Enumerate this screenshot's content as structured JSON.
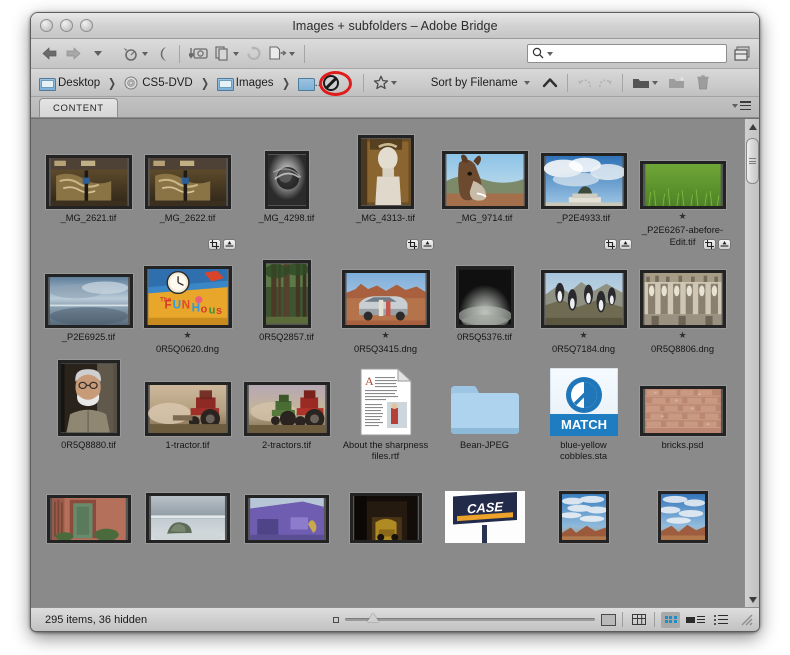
{
  "window": {
    "title": "Images + subfolders – Adobe Bridge",
    "traffic_lights": [
      "close-button",
      "minimize-button",
      "zoom-button"
    ]
  },
  "toolbar": {
    "back_icon": "back-arrow-icon",
    "forward_icon": "forward-arrow-icon",
    "recent_dropdown_icon": "chevron-down-icon",
    "reveal_icon": "reveal-in-finder-icon",
    "boomerang_icon": "return-to-adobe-icon",
    "camera_icon": "get-photos-from-camera-icon",
    "refine_icon": "refine-icon",
    "rotate_icon": "rotate-counterclockwise-icon",
    "open_in_icon": "open-in-camera-raw-icon",
    "search_placeholder": "",
    "search_value": "",
    "search_icon": "search-icon",
    "panel_toggle_icon": "toggle-panels-icon"
  },
  "pathbar": {
    "crumbs": [
      {
        "label": "Desktop",
        "icon": "folder-icon"
      },
      {
        "label": "CS5-DVD",
        "icon": "disc-icon"
      },
      {
        "label": "Images",
        "icon": "folder-icon"
      }
    ],
    "drag_target": {
      "icon": "no-entry-cursor-icon",
      "annotation": "red-highlight-ellipse"
    },
    "separator": "❯",
    "filter_icon": "star-filter-icon",
    "sort_label": "Sort by Filename",
    "sort_direction_icon": "chevron-up-icon",
    "undo_icon": "undo-icon",
    "redo_icon": "redo-icon",
    "new_folder_icon": "open-folder-icon",
    "create_folder_icon": "new-folder-icon",
    "delete_icon": "trash-icon"
  },
  "tabs": [
    {
      "label": "CONTENT",
      "active": true
    }
  ],
  "panel_menu_icon": "panel-menu-icon",
  "content": {
    "rows": [
      {
        "items": [
          {
            "name": "_MG_2621.tif",
            "art": "frieze",
            "stars": 0,
            "badges": []
          },
          {
            "name": "_MG_2622.tif",
            "art": "frieze",
            "stars": 0,
            "badges": []
          },
          {
            "name": "_MG_4298.tif",
            "art": "sphere-bw",
            "stars": 0,
            "badges": []
          },
          {
            "name": "_MG_4313-.tif",
            "art": "bust",
            "stars": 0,
            "badges": []
          },
          {
            "name": "_MG_9714.tif",
            "art": "okapi",
            "stars": 0,
            "badges": []
          },
          {
            "name": "_P2E4933.tif",
            "art": "monument-sky",
            "stars": 0,
            "badges": []
          },
          {
            "name": "_P2E6267-abefore-Edit.tif",
            "art": "grass",
            "stars": 1,
            "badges": []
          }
        ]
      },
      {
        "items": [
          {
            "name": "_P2E6925.tif",
            "art": "seascape",
            "stars": 0,
            "badges": []
          },
          {
            "name": "0R5Q0620.dng",
            "art": "funhouse",
            "stars": 1,
            "badges": [
              "crop-badge",
              "adjust-badge"
            ]
          },
          {
            "name": "0R5Q2857.tif",
            "art": "redwoods",
            "stars": 0,
            "badges": []
          },
          {
            "name": "0R5Q3415.dng",
            "art": "desert-car",
            "stars": 1,
            "badges": [
              "crop-badge",
              "adjust-badge"
            ]
          },
          {
            "name": "0R5Q5376.tif",
            "art": "dark-fog",
            "stars": 0,
            "badges": []
          },
          {
            "name": "0R5Q7184.dng",
            "art": "penguins",
            "stars": 1,
            "badges": [
              "crop-badge",
              "adjust-badge"
            ]
          },
          {
            "name": "0R5Q8806.dng",
            "art": "cathedral",
            "stars": 1,
            "badges": [
              "crop-badge",
              "adjust-badge"
            ]
          }
        ]
      },
      {
        "items": [
          {
            "name": "0R5Q8880.tif",
            "art": "portrait-man",
            "stars": 0,
            "badges": []
          },
          {
            "name": "1-tractor.tif",
            "art": "tractor1",
            "stars": 0,
            "badges": []
          },
          {
            "name": "2-tractors.tif",
            "art": "tractor2",
            "stars": 0,
            "badges": []
          },
          {
            "name": "About the sharpness files.rtf",
            "art": "rtf-doc",
            "stars": 0,
            "badges": []
          },
          {
            "name": "Bean-JPEG",
            "art": "folder",
            "stars": 0,
            "badges": []
          },
          {
            "name": "blue-yellow cobbles.sta",
            "art": "match-app",
            "stars": 0,
            "badges": []
          },
          {
            "name": "bricks.psd",
            "art": "bricks",
            "stars": 0,
            "badges": []
          }
        ]
      },
      {
        "items": [
          {
            "name": "",
            "art": "adobe-door",
            "stars": 0,
            "badges": []
          },
          {
            "name": "",
            "art": "beach-rock",
            "stars": 0,
            "badges": []
          },
          {
            "name": "",
            "art": "purple-barn",
            "stars": 0,
            "badges": []
          },
          {
            "name": "",
            "art": "dark-loader",
            "stars": 0,
            "badges": []
          },
          {
            "name": "",
            "art": "case-sign",
            "stars": 0,
            "badges": []
          },
          {
            "name": "",
            "art": "mesa-sky",
            "stars": 0,
            "badges": []
          },
          {
            "name": "",
            "art": "mesa-sky2",
            "stars": 0,
            "badges": []
          }
        ]
      }
    ]
  },
  "scrollbar": {
    "up_arrow_icon": "scroll-up-arrow-icon",
    "down_arrow_icon": "scroll-down-arrow-icon",
    "thumb_position_percent": 4
  },
  "statusbar": {
    "items_text": "295 items, 36 hidden",
    "zoom_small_icon": "small-thumbnail-icon",
    "zoom_large_icon": "large-thumbnail-icon",
    "zoom_slider_percent": 9,
    "view_buttons": [
      {
        "name": "lock-thumbnail-grid-button",
        "icon": "grid-lock-icon",
        "active": false
      },
      {
        "name": "grid-view-button",
        "icon": "grid-view-icon",
        "active": true
      },
      {
        "name": "details-view-button",
        "icon": "details-view-icon",
        "active": false
      },
      {
        "name": "list-view-button",
        "icon": "list-view-icon",
        "active": false
      }
    ],
    "resize_grip_icon": "resize-grip-icon"
  },
  "colors": {
    "content_bg": "#8a8a8a",
    "chrome": "#cfcfcf",
    "accent_blue": "#1d8fc4",
    "annotation_red": "#e01b1b"
  }
}
